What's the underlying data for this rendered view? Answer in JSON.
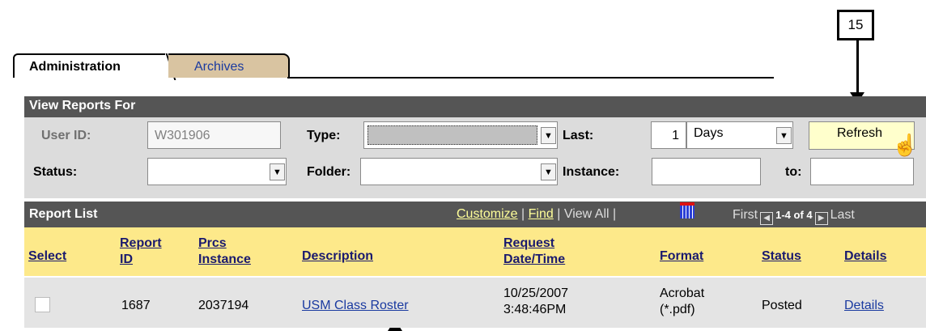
{
  "callout": {
    "number": "15"
  },
  "tabs": [
    {
      "label": "Administration",
      "active": true
    },
    {
      "label": "Archives",
      "active": false
    }
  ],
  "view_reports": {
    "header": "View Reports For",
    "user_id_label": "User ID:",
    "user_id_value": "W301906",
    "type_label": "Type:",
    "type_value": "",
    "last_label": "Last:",
    "last_value": "1",
    "last_unit": "Days",
    "refresh_label": "Refresh",
    "status_label": "Status:",
    "status_value": "",
    "folder_label": "Folder:",
    "folder_value": "",
    "instance_label": "Instance:",
    "instance_from": "",
    "to_label": "to:",
    "instance_to": ""
  },
  "report_list": {
    "header": "Report List",
    "customize": "Customize",
    "find": "Find",
    "view_all": "View All",
    "sep": "|",
    "first": "First",
    "range": "1-4 of 4",
    "last": "Last",
    "columns": {
      "select": "Select",
      "report_id": [
        "Report",
        "ID"
      ],
      "prcs_instance": [
        "Prcs",
        "Instance"
      ],
      "description": "Description",
      "request_datetime": [
        "Request",
        "Date/Time"
      ],
      "format": "Format",
      "status": "Status",
      "details": "Details"
    },
    "rows": [
      {
        "report_id": "1687",
        "prcs_instance": "2037194",
        "description": "USM Class Roster",
        "date": "10/25/2007",
        "time": "3:48:46PM",
        "format_line1": "Acrobat",
        "format_line2": "(*.pdf)",
        "status": "Posted",
        "details": "Details"
      }
    ]
  },
  "colors": {
    "header_bar": "#555555",
    "table_header": "#fde98a",
    "archive_tab": "#d9c4a1",
    "refresh_button": "#ffffcc",
    "link": "#1a3aa0"
  }
}
